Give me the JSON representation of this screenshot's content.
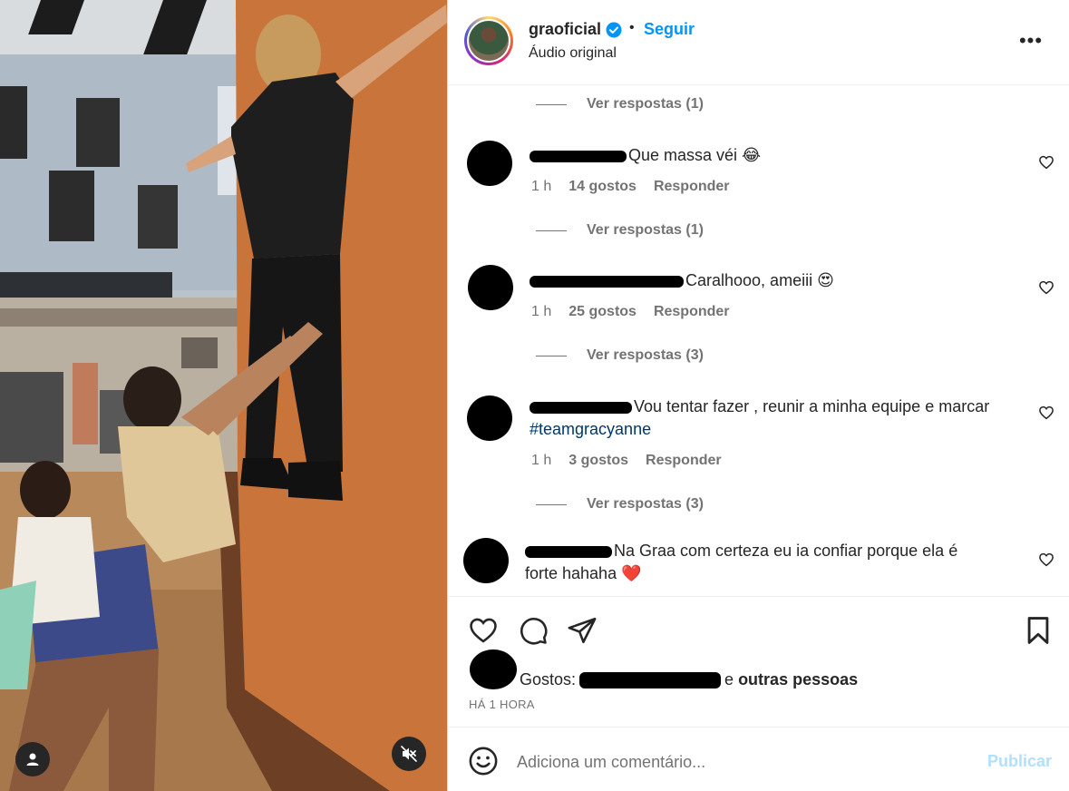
{
  "post": {
    "username": "graoficial",
    "dot": "•",
    "follow_label": "Seguir",
    "audio_label": "Áudio original",
    "more_label": "•••"
  },
  "comments": {
    "replies": [
      {
        "label": "Ver respostas (1)"
      },
      {
        "label": "Ver respostas (1)"
      },
      {
        "label": "Ver respostas (3)"
      },
      {
        "label": "Ver respostas (3)"
      }
    ],
    "items": [
      {
        "text": "Que massa véi 😂",
        "time": "1 h",
        "likes": "14 gostos",
        "reply": "Responder"
      },
      {
        "text": "Caralhooo, ameiii 😍",
        "time": "1 h",
        "likes": "25 gostos",
        "reply": "Responder"
      },
      {
        "text": "Vou tentar fazer , reunir a minha equipe e marcar",
        "hashtag": "#teamgracyanne",
        "time": "1 h",
        "likes": "3 gostos",
        "reply": "Responder"
      },
      {
        "text": "Na Graa com certeza eu ia confiar porque ela é",
        "text2": "forte hahaha ❤️"
      }
    ]
  },
  "likes": {
    "prefix": "Gostos:",
    "connector": "e",
    "others": "outras pessoas",
    "time": "HÁ 1 HORA"
  },
  "add_comment": {
    "placeholder": "Adiciona um comentário...",
    "publish_label": "Publicar"
  },
  "icons": {
    "verified": "verified-badge-icon",
    "more": "more-options-icon",
    "heart": "heart-icon",
    "comment": "comment-icon",
    "share": "share-icon",
    "save": "bookmark-icon",
    "emoji": "emoji-icon",
    "user_tag": "user-icon",
    "mute": "audio-muted-icon"
  },
  "colors": {
    "accent": "#0095f6",
    "publish_disabled": "#b2dffc",
    "secondary_text": "#737373",
    "hashtag": "#00376b"
  }
}
